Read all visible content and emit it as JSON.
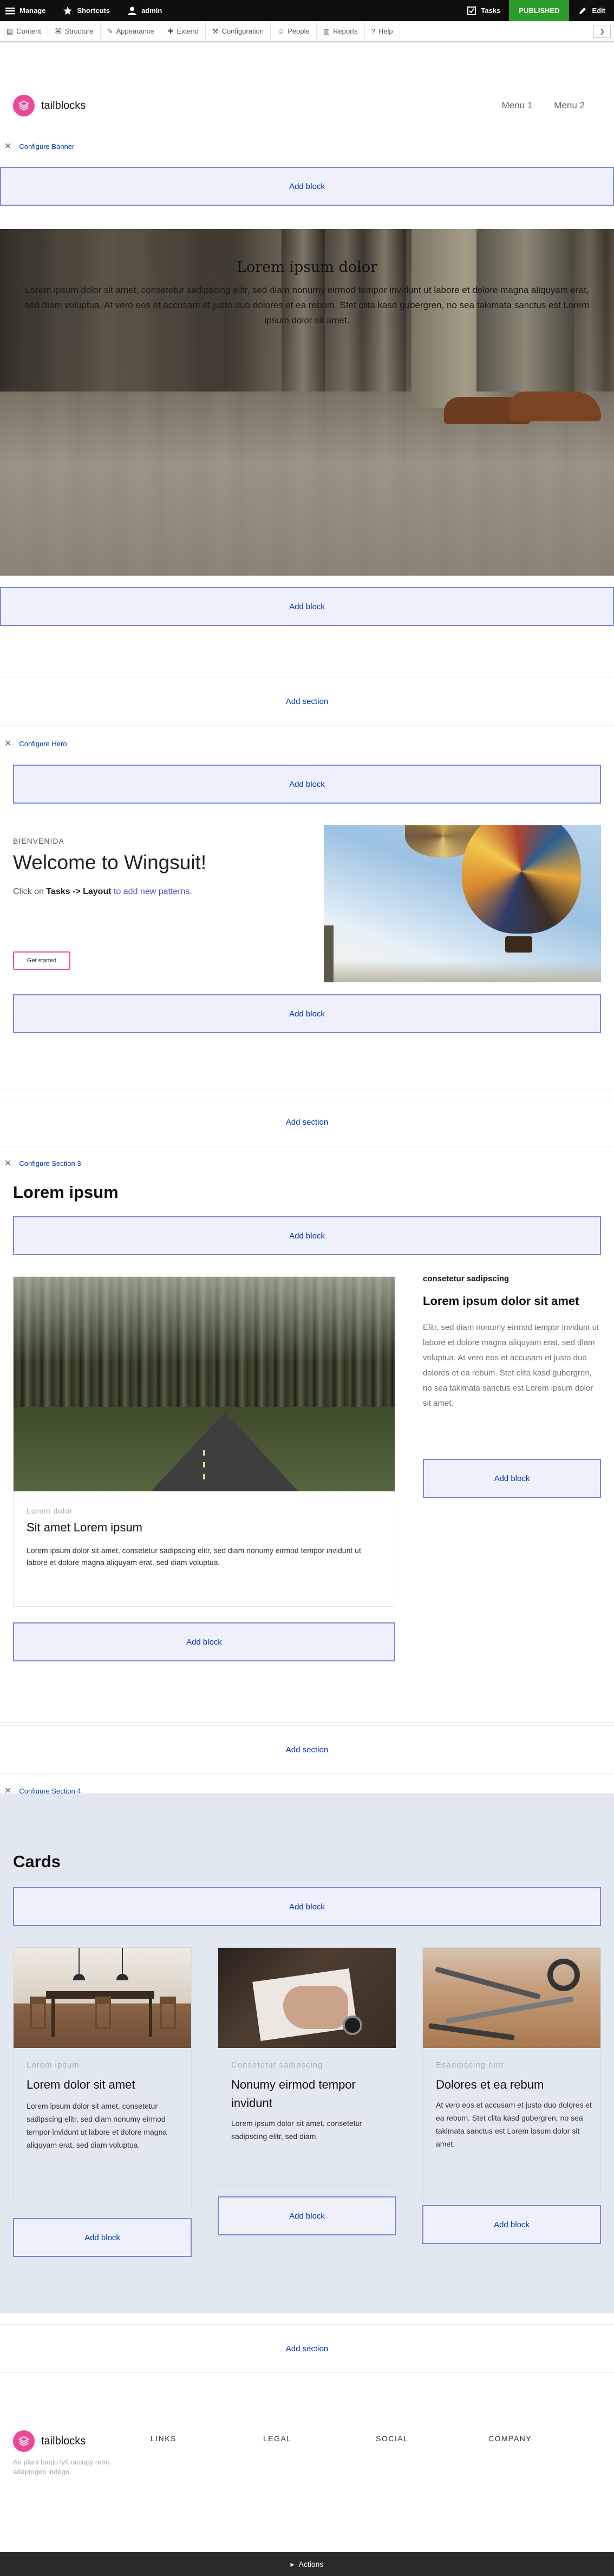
{
  "toolbar": {
    "manage": "Manage",
    "shortcuts": "Shortcuts",
    "user": "admin",
    "tasks": "Tasks",
    "published": "PUBLISHED",
    "edit": "Edit"
  },
  "tray": {
    "items": [
      "Content",
      "Structure",
      "Appearance",
      "Extend",
      "Configuration",
      "People",
      "Reports",
      "Help"
    ]
  },
  "header": {
    "logo_text": "tailblocks",
    "menu": [
      "Menu 1",
      "Menu 2"
    ]
  },
  "layout_builder": {
    "add_block": "Add block",
    "add_section": "Add section",
    "configure_banner": "Configure Banner",
    "configure_hero": "Configure Hero",
    "configure_section3": "Configure Section 3",
    "configure_section4": "Configure Section 4"
  },
  "banner": {
    "title": "Lorem ipsum dolor",
    "text": "Lorem ipsum dolor sit amet, consetetur sadipscing elitr, sed diam nonumy eirmod tempor invidunt ut labore et dolore magna aliquyam erat, sed diam voluptua. At vero eos et accusam et justo duo dolores et ea rebum. Stet clita kasd gubergren, no sea takimata sanctus est Lorem ipsum dolor sit amet."
  },
  "hero": {
    "eyebrow": "BIENVENIDA",
    "title": "Welcome to Wingsuit!",
    "text_pre": "Click on ",
    "text_bold": "Tasks -> Layout",
    "text_post": " to add new patterns",
    "text_end": ".",
    "button": "Get started"
  },
  "section3": {
    "title": "Lorem ipsum",
    "card": {
      "subtitle": "Lorem dolor",
      "title": "Sit amet Lorem ipsum",
      "text": "Lorem ipsum dolor sit amet, consetetur sadipscing elitr, sed diam nonumy eirmod tempor invidunt ut labore et dolore magna aliquyam erat, sed diam voluptua."
    },
    "side": {
      "subtitle": "consetetur sadipscing",
      "title": "Lorem ipsum dolor sit amet",
      "text": "Elitr, sed diam nonumy eirmod tempor invidunt ut labore et dolore magna aliquyam erat, sed diam voluptua. At vero eos et accusam et justo duo dolores et ea rebum. Stet clita kasd gubergren, no sea takimata sanctus est Lorem ipsum dolor sit amet."
    }
  },
  "section4": {
    "title": "Cards",
    "cards": [
      {
        "subtitle": "Lorem ipsum",
        "title": "Lorem dolor sit amet",
        "text": "Lorem ipsum dolor sit amet, consetetur sadipscing elitr, sed diam nonumy eirmod tempor invidunt ut labore et dolore magna aliquyam erat, sed diam voluptua."
      },
      {
        "subtitle": "Consetetur sadipscing",
        "title": "Nonumy eirmod tempor invidunt",
        "text": "Lorem ipsum dolor sit amet, consetetur sadipscing elitr, sed diam."
      },
      {
        "subtitle": "Esadipscing elitr",
        "title": "Dolores et ea rebum",
        "text": "At vero eos et accusam et justo duo dolores et ea rebum. Stet clita kasd gubergren, no sea takimata sanctus est Lorem ipsum dolor sit amet."
      }
    ]
  },
  "footer": {
    "logo_text": "tailblocks",
    "tagline": "Air plant banjo lyft occupy retro adaptogen indego",
    "columns": [
      "LINKS",
      "LEGAL",
      "SOCIAL",
      "COMPANY"
    ]
  },
  "actions_bar": {
    "label": "Actions"
  },
  "colors": {
    "accent": "#ec4899",
    "link": "#0036b1",
    "published": "#2d9c2d",
    "section4_bg": "#e2e8f0"
  }
}
